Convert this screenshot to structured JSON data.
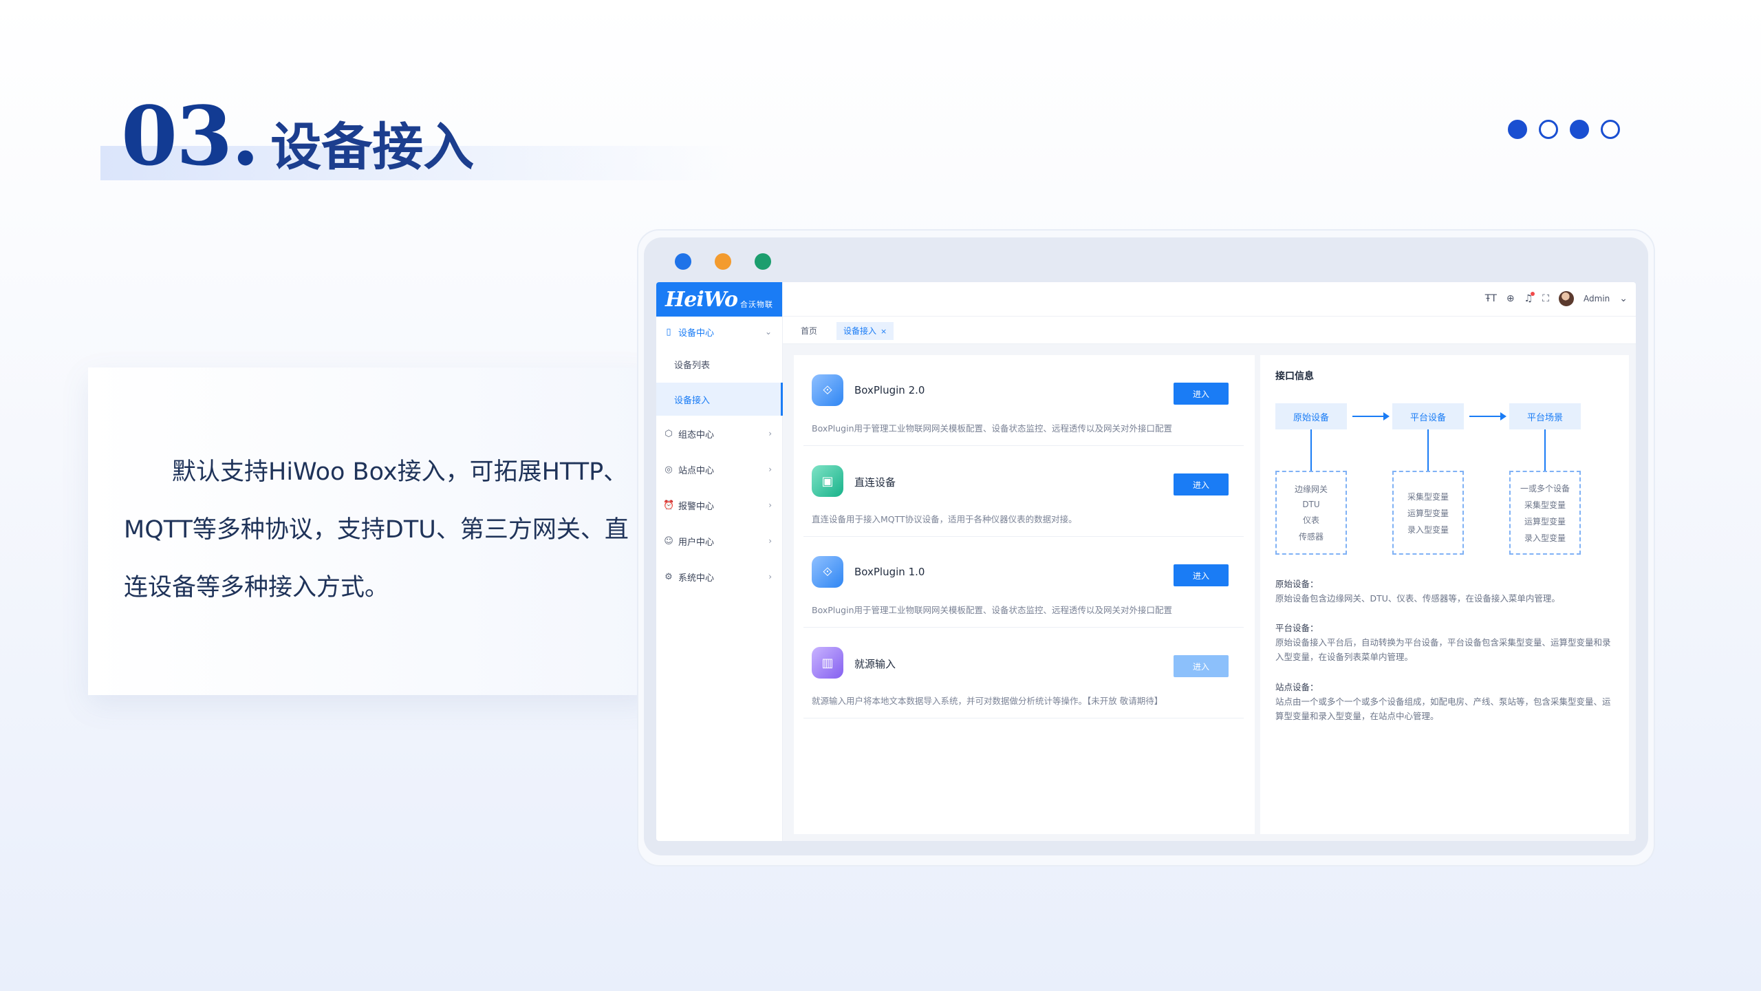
{
  "slide": {
    "number": "03.",
    "title": "设备接入",
    "pager": [
      true,
      false,
      true,
      false
    ],
    "description": "默认支持HiWoo Box接入，可拓展HTTP、MQTT等多种协议，支持DTU、第三方网关、直连设备等多种接入方式。"
  },
  "app": {
    "logo": {
      "mark": "HeiWo",
      "sub": "合沃物联"
    },
    "topbar": {
      "user": "Admin"
    },
    "menu": [
      {
        "label": "设备中心",
        "icon": "device-icon",
        "open": true
      },
      {
        "label": "组态中心",
        "icon": "config-icon"
      },
      {
        "label": "站点中心",
        "icon": "location-icon"
      },
      {
        "label": "报警中心",
        "icon": "alarm-icon"
      },
      {
        "label": "用户中心",
        "icon": "user-icon"
      },
      {
        "label": "系统中心",
        "icon": "settings-icon"
      }
    ],
    "submenu": [
      {
        "label": "设备列表"
      },
      {
        "label": "设备接入",
        "active": true
      }
    ],
    "tabs": {
      "home": "首页",
      "active": "设备接入",
      "close": "×"
    },
    "plugins": [
      {
        "name": "BoxPlugin 2.0",
        "button": "进入",
        "desc": "BoxPlugin用于管理工业物联网网关模板配置、设备状态监控、远程透传以及网关对外接口配置",
        "color": "#2f86f3"
      },
      {
        "name": "直连设备",
        "button": "进入",
        "desc": "直连设备用于接入MQTT协议设备，适用于各种仪器仪表的数据对接。",
        "color": "#18b28a"
      },
      {
        "name": "BoxPlugin 1.0",
        "button": "进入",
        "desc": "BoxPlugin用于管理工业物联网网关模板配置、设备状态监控、远程透传以及网关对外接口配置",
        "color": "#2f86f3"
      },
      {
        "name": "就源输入",
        "button": "进入",
        "desc": "就源输入用户将本地文本数据导入系统，并可对数据做分析统计等操作。【未开放 敬请期待】",
        "color": "#8460f0",
        "disabled": true
      }
    ],
    "interface": {
      "title": "接口信息",
      "flow": [
        {
          "label": "原始设备",
          "items": [
            "边缘网关",
            "DTU",
            "仪表",
            "传感器"
          ]
        },
        {
          "label": "平台设备",
          "items": [
            "采集型变量",
            "运算型变量",
            "录入型变量"
          ]
        },
        {
          "label": "平台场景",
          "items": [
            "一或多个设备",
            "采集型变量",
            "运算型变量",
            "录入型变量"
          ]
        }
      ],
      "notes": [
        {
          "title": "原始设备：",
          "text": "原始设备包含边缘网关、DTU、仪表、传感器等，在设备接入菜单内管理。"
        },
        {
          "title": "平台设备：",
          "text": "原始设备接入平台后，自动转换为平台设备，平台设备包含采集型变量、运算型变量和录入型变量，在设备列表菜单内管理。"
        },
        {
          "title": "站点设备：",
          "text": "站点由一个或多个一个或多个设备组成，如配电房、产线、泵站等，包含采集型变量、运算型变量和录入型变量，在站点中心管理。"
        }
      ]
    }
  }
}
